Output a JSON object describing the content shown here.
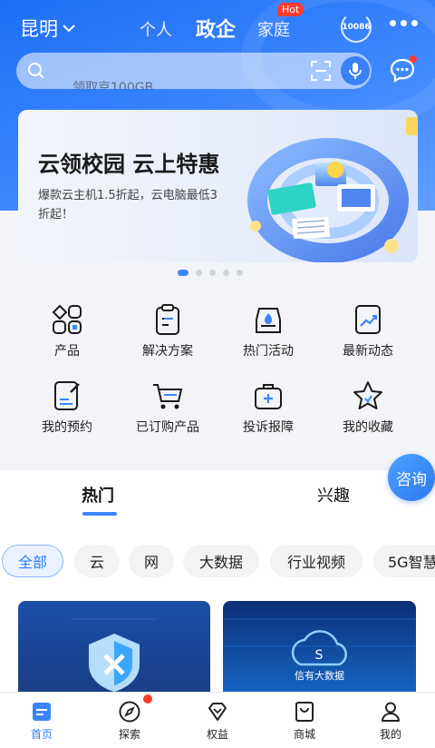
{
  "header": {
    "city": "昆明",
    "tabs": [
      {
        "label": "个人"
      },
      {
        "label": "政企"
      },
      {
        "label": "家庭"
      }
    ],
    "hot_badge": "Hot",
    "service_badge": "10086"
  },
  "search": {
    "placeholder": "领取京100GB"
  },
  "banner": {
    "title": "云领校园 云上特惠",
    "subtitle": "爆款云主机1.5折起，云电脑最低3折起！"
  },
  "grid": [
    {
      "label": "产品",
      "icon": "product-grid-icon"
    },
    {
      "label": "解决方案",
      "icon": "clipboard-icon"
    },
    {
      "label": "热门活动",
      "icon": "hot-activity-icon"
    },
    {
      "label": "最新动态",
      "icon": "trend-icon"
    },
    {
      "label": "我的预约",
      "icon": "appointment-icon"
    },
    {
      "label": "已订购产品",
      "icon": "cart-icon"
    },
    {
      "label": "投诉报障",
      "icon": "first-aid-icon"
    },
    {
      "label": "我的收藏",
      "icon": "star-icon"
    }
  ],
  "content_tabs": [
    {
      "label": "热门"
    },
    {
      "label": "兴趣"
    }
  ],
  "consult_label": "咨询",
  "chips": [
    {
      "label": "全部"
    },
    {
      "label": "云"
    },
    {
      "label": "网"
    },
    {
      "label": "大数据"
    },
    {
      "label": "行业视频"
    },
    {
      "label": "5G智慧"
    }
  ],
  "cards": {
    "card2_caption": "信有大数据"
  },
  "bottom_nav": [
    {
      "label": "首页"
    },
    {
      "label": "探索"
    },
    {
      "label": "权益"
    },
    {
      "label": "商城"
    },
    {
      "label": "我的"
    }
  ],
  "colors": {
    "accent": "#2f7cf6",
    "header_gradient_start": "#1f6ef5",
    "badge_red": "#ff3b30"
  }
}
